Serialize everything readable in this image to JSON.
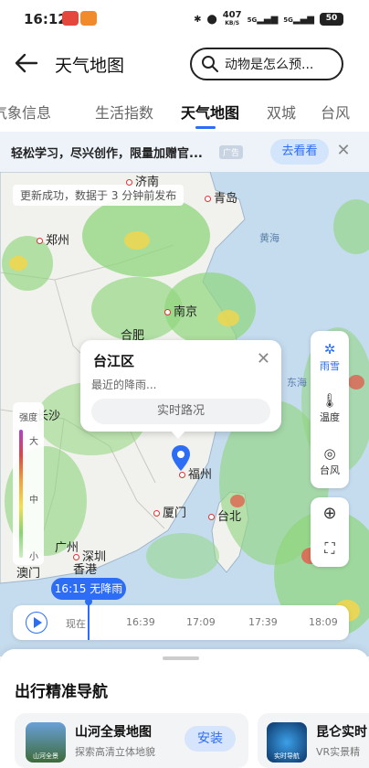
{
  "status_bar": {
    "time": "16:12",
    "net_speed": "407",
    "net_unit": "KB/S",
    "signal1": "5G",
    "signal2": "5G",
    "battery": "50"
  },
  "header": {
    "title": "天气地图",
    "search_placeholder": "动物是怎么预..."
  },
  "tabs": [
    {
      "label": "气象信息",
      "active": false
    },
    {
      "label": "生活指数",
      "active": false
    },
    {
      "label": "天气地图",
      "active": true
    },
    {
      "label": "双城",
      "active": false
    },
    {
      "label": "台风",
      "active": false
    }
  ],
  "ad": {
    "text": "轻松学习，尽兴创作，限量加赠官...",
    "tag": "广告",
    "button": "去看看",
    "close": "✕"
  },
  "map": {
    "update_message": "更新成功，数据于 3 分钟前发布",
    "cities": [
      "济南",
      "青岛",
      "郑州",
      "黄海",
      "南京",
      "合肥",
      "长沙",
      "东海",
      "福州",
      "厦门",
      "台北",
      "广州",
      "深圳",
      "香港",
      "澳门"
    ],
    "legend": {
      "title": "强度",
      "high": "大",
      "mid": "中",
      "low": "小"
    },
    "popup": {
      "title": "台江区",
      "description": "最近的降雨...",
      "button": "实时路况",
      "close": "✕"
    },
    "controls": [
      {
        "icon": "rain-snow-icon",
        "label": "雨雪",
        "active": true
      },
      {
        "icon": "thermometer-icon",
        "label": "温度",
        "active": false
      },
      {
        "icon": "typhoon-icon",
        "label": "台风",
        "active": false
      }
    ],
    "timeline": {
      "current_tip": "16:15 无降雨",
      "ticks": [
        "现在",
        "16:39",
        "17:09",
        "17:39",
        "18:09"
      ]
    }
  },
  "sheet": {
    "title": "出行精准导航",
    "cards": [
      {
        "name": "山河全景地图",
        "desc": "探索高清立体地貌",
        "button": "安装",
        "thumb_label": "山河全景"
      },
      {
        "name": "昆仑实时",
        "desc": "VR实景精",
        "button": "",
        "thumb_label": "实时导航"
      }
    ]
  },
  "colors": {
    "accent": "#2d6cf5",
    "sea": "#c5dcee",
    "land": "#f1f1ee",
    "rain_light": "#8fd67c",
    "rain_mid": "#f3d64a",
    "rain_heavy": "#e25a4a"
  }
}
